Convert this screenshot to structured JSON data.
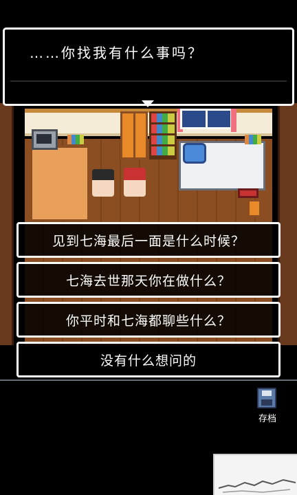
{
  "dialog": {
    "text": "……你找我有什么事吗？"
  },
  "choices": [
    {
      "label": "见到七海最后一面是什么时候？"
    },
    {
      "label": "七海去世那天你在做什么？"
    },
    {
      "label": "你平时和七海都聊些什么？"
    },
    {
      "label": "没有什么想问的"
    }
  ],
  "toolbar": {
    "save_label": "存档",
    "save_icon": "floppy-disk-icon"
  },
  "colors": {
    "dialog_bg": "#000000",
    "dialog_border": "#ffffff",
    "save_icon": "#5a7aa8"
  }
}
